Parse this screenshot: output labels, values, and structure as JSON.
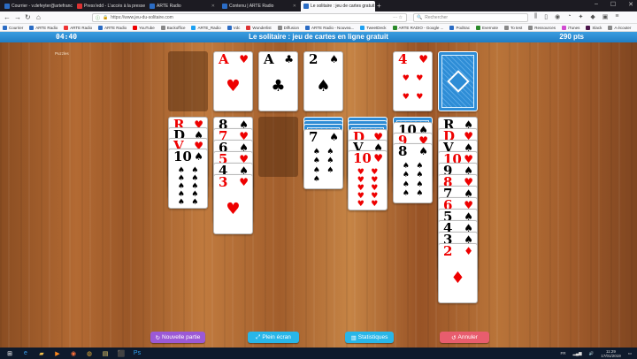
{
  "browser": {
    "tabs": [
      {
        "title": "Courrier - v.defeyter@artefrance.fr",
        "color": "#2b6cc4",
        "active": false
      },
      {
        "title": "Press'edd - L'accès à la presse",
        "color": "#d33",
        "active": false
      },
      {
        "title": "ARTE Radio",
        "color": "#2b6cc4",
        "active": false
      },
      {
        "title": "Contenu | ARTE Radio",
        "color": "#2b6cc4",
        "active": false
      },
      {
        "title": "Le solitaire : jeu de cartes gratuit",
        "color": "#2b6cc4",
        "active": true
      }
    ],
    "url": "https://www.jeu-du-solitaire.com",
    "search_placeholder": "Rechercher",
    "bookmarks": [
      {
        "label": "Courrier",
        "color": "#2b6cc4"
      },
      {
        "label": "ARTE Radio",
        "color": "#2b6cc4"
      },
      {
        "label": "ARTE Radio",
        "color": "#e33"
      },
      {
        "label": "ARTE Radio",
        "color": "#2b6cc4"
      },
      {
        "label": "YouTube",
        "color": "#e00"
      },
      {
        "label": "Backoffice",
        "color": "#888"
      },
      {
        "label": "ARTE_Radio",
        "color": "#1da1f2"
      },
      {
        "label": "Vdc",
        "color": "#2b6cc4"
      },
      {
        "label": "Wunderlist",
        "color": "#d33"
      },
      {
        "label": "Diffusion",
        "color": "#888"
      },
      {
        "label": "ARTE Radio - Nouvea...",
        "color": "#2b6cc4"
      },
      {
        "label": "TweetDeck",
        "color": "#1da1f2"
      },
      {
        "label": "ARTE RADIO - Google ...",
        "color": "#2a8a2a"
      },
      {
        "label": "Podtrac",
        "color": "#2b6cc4"
      },
      {
        "label": "Evernote",
        "color": "#2a8a2a"
      },
      {
        "label": "To test",
        "color": "#888"
      },
      {
        "label": "Ressources",
        "color": "#888"
      },
      {
        "label": "iTunes",
        "color": "#d14ad1"
      },
      {
        "label": "Slack",
        "color": "#4a154b"
      },
      {
        "label": "A écouter",
        "color": "#888"
      }
    ]
  },
  "game": {
    "timer": "04:40",
    "title": "Le solitaire : jeu de cartes en ligne gratuit",
    "score": "290 pts",
    "mode": "Puzzles",
    "foundations": [
      {
        "rank": "",
        "suit": "",
        "color": "",
        "empty": true
      },
      {
        "rank": "A",
        "suit": "♥",
        "color": "red"
      },
      {
        "rank": "A",
        "suit": "♣",
        "color": "black"
      },
      {
        "rank": "2",
        "suit": "♠",
        "color": "black"
      }
    ],
    "waste": {
      "rank": "4",
      "suit": "♥",
      "color": "red"
    },
    "tableau": [
      {
        "hidden": 0,
        "cards": [
          {
            "rank": "R",
            "suit": "♥",
            "color": "red"
          },
          {
            "rank": "D",
            "suit": "♠",
            "color": "black"
          },
          {
            "rank": "V",
            "suit": "♥",
            "color": "red"
          },
          {
            "rank": "10",
            "suit": "♠",
            "color": "black"
          }
        ]
      },
      {
        "hidden": 0,
        "cards": [
          {
            "rank": "8",
            "suit": "♠",
            "color": "black"
          },
          {
            "rank": "7",
            "suit": "♥",
            "color": "red"
          },
          {
            "rank": "6",
            "suit": "♠",
            "color": "black"
          },
          {
            "rank": "5",
            "suit": "♥",
            "color": "red"
          },
          {
            "rank": "4",
            "suit": "♠",
            "color": "black"
          },
          {
            "rank": "3",
            "suit": "♥",
            "color": "red"
          }
        ]
      },
      {
        "hidden": 0,
        "cards": []
      },
      {
        "hidden": 3,
        "cards": [
          {
            "rank": "7",
            "suit": "♠",
            "color": "black"
          }
        ]
      },
      {
        "hidden": 3,
        "cards": [
          {
            "rank": "D",
            "suit": "♥",
            "color": "red"
          },
          {
            "rank": "V",
            "suit": "♠",
            "color": "black"
          },
          {
            "rank": "10",
            "suit": "♥",
            "color": "red"
          }
        ]
      },
      {
        "hidden": 1,
        "cards": [
          {
            "rank": "10",
            "suit": "♠",
            "color": "black"
          },
          {
            "rank": "9",
            "suit": "♥",
            "color": "red"
          },
          {
            "rank": "8",
            "suit": "♠",
            "color": "black"
          }
        ]
      },
      {
        "hidden": 0,
        "cards": [
          {
            "rank": "R",
            "suit": "♠",
            "color": "black"
          },
          {
            "rank": "D",
            "suit": "♥",
            "color": "red"
          },
          {
            "rank": "V",
            "suit": "♠",
            "color": "black"
          },
          {
            "rank": "10",
            "suit": "♥",
            "color": "red"
          },
          {
            "rank": "9",
            "suit": "♠",
            "color": "black"
          },
          {
            "rank": "8",
            "suit": "♥",
            "color": "red"
          },
          {
            "rank": "7",
            "suit": "♠",
            "color": "black"
          },
          {
            "rank": "6",
            "suit": "♥",
            "color": "red"
          },
          {
            "rank": "5",
            "suit": "♠",
            "color": "black"
          },
          {
            "rank": "4",
            "suit": "♠",
            "color": "black"
          },
          {
            "rank": "3",
            "suit": "♠",
            "color": "black"
          },
          {
            "rank": "2",
            "suit": "♦",
            "color": "red"
          }
        ]
      }
    ],
    "buttons": [
      {
        "label": "Nouvelle partie",
        "icon": "↻",
        "color": "#9b59d6",
        "name": "new-game-button"
      },
      {
        "label": "Plein écran",
        "icon": "⤢",
        "color": "#29b6e8",
        "name": "fullscreen-button"
      },
      {
        "label": "Statistiques",
        "icon": "▥",
        "color": "#29b6e8",
        "name": "statistics-button"
      },
      {
        "label": "Annuler",
        "icon": "↺",
        "color": "#e85d6e",
        "name": "undo-button"
      }
    ]
  },
  "taskbar": {
    "language": "FR",
    "time": "11:29",
    "date": "17/01/2019"
  }
}
